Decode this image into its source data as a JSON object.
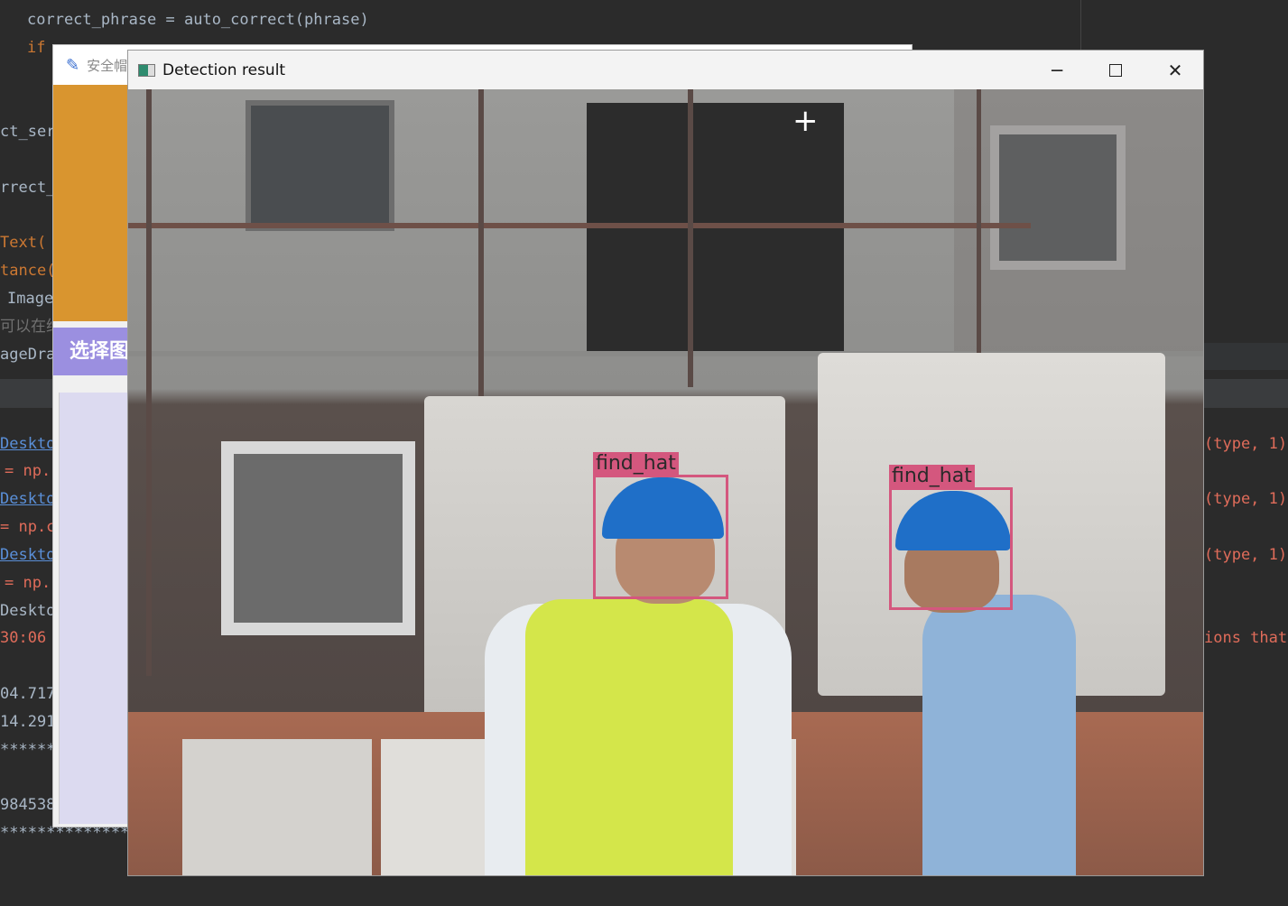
{
  "editor": {
    "top_lines": [
      {
        "text": "correct_phrase = auto_correct(phrase)"
      },
      {
        "text": "if"
      }
    ],
    "left_fragments": [
      "ct_ser",
      "rrect_",
      "Text(",
      "tance(",
      "Image",
      "可以在给",
      "ageDra"
    ],
    "console_left": [
      "Deskto",
      "= np.",
      "Deskto",
      "= np.c",
      "Deskto",
      "= np.",
      "Deskto",
      "30:06",
      "04.717",
      "14.291",
      "******",
      "984538",
      "**************"
    ],
    "console_right": [
      "(type, 1)",
      "(type, 1)",
      "(type, 1)",
      "ions that"
    ]
  },
  "tk_window": {
    "title": "安全帽",
    "button_label": "选择图",
    "accent": "#d9952f",
    "button_color": "#9b8fe0"
  },
  "detection_window": {
    "title": "Detection result",
    "controls": {
      "minimize": "minimize-icon",
      "maximize": "maximize-icon",
      "close": "close-icon"
    },
    "detections": [
      {
        "label": "find_hat"
      },
      {
        "label": "find_hat"
      }
    ],
    "box_color": "#d4577e"
  }
}
